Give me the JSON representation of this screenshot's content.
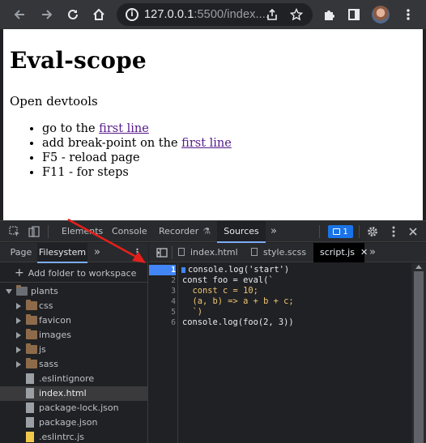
{
  "browser": {
    "url_host": "127.0.0.1",
    "url_rest": ":5500/index...."
  },
  "page": {
    "title": "Eval-scope",
    "intro": "Open devtools",
    "steps": [
      {
        "text": "go to the ",
        "link": "first line"
      },
      {
        "text": "add break-point on the ",
        "link": "first line"
      },
      {
        "text": "F5 - reload page",
        "link": ""
      },
      {
        "text": "F11 - for steps",
        "link": ""
      }
    ]
  },
  "devtools": {
    "tabs": [
      "Elements",
      "Console",
      "Recorder",
      "Sources"
    ],
    "active_tab": "Sources",
    "issues_count": "1",
    "navigator": {
      "tabs": [
        "Page",
        "Filesystem"
      ],
      "active_tab": "Filesystem",
      "add_folder_label": "Add folder to workspace",
      "root_folder": "plants",
      "folders": [
        "css",
        "favicon",
        "images",
        "js",
        "sass"
      ],
      "files": [
        ".eslintignore",
        "index.html",
        "package-lock.json",
        "package.json",
        ".eslintrc.js"
      ],
      "selected_file": "index.html"
    },
    "editor": {
      "tabs": [
        "index.html",
        "style.scss",
        "script.js"
      ],
      "active_tab": "script.js",
      "line_numbers": [
        "1",
        "2",
        "3",
        "4",
        "5",
        "6"
      ],
      "breakpoint_line": "1",
      "code_lines": [
        "console.log('start')",
        "const foo = eval(`",
        "  const c = 10;",
        "  (a, b) => a + b + c;",
        "  `)",
        "console.log(foo(2, 3))"
      ]
    }
  },
  "colors": {
    "accent": "#7cacf8",
    "breakpoint": "#4285f4",
    "annotation_arrow": "#e3201b",
    "link": "#551a8b"
  }
}
